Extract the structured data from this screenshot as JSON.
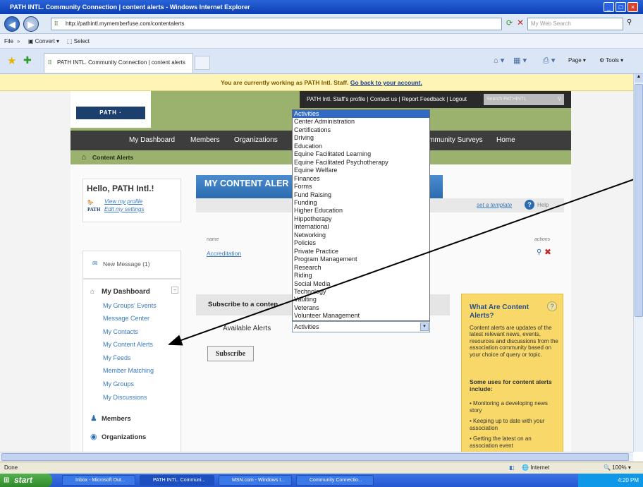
{
  "window": {
    "title": "PATH INTL. Community Connection | content alerts - Windows Internet Explorer"
  },
  "browser": {
    "url": "http://pathintl.mymemberfuse.com/contentalerts",
    "search_placeholder": "My Web Search",
    "menu": {
      "file": "File",
      "convert": "Convert",
      "select": "Select"
    },
    "tab_title": "PATH INTL. Community Connection | content alerts",
    "tools": {
      "page": "Page",
      "tools": "Tools"
    }
  },
  "infobar": {
    "text": "You are currently working as PATH Intl. Staff.",
    "link": "Go back to your account."
  },
  "site": {
    "top_links": "PATH Intl. Staff's profile | Contact us | Report Feedback | Logout",
    "search_placeholder": "Search PATHINTL",
    "nav": [
      "My Dashboard",
      "Members",
      "Organizations",
      "mmunity Surveys",
      "Home"
    ],
    "breadcrumb": "Content Alerts"
  },
  "sidebar": {
    "greeting": "Hello, PATH Intl.!",
    "view_profile": "View my profile",
    "edit_settings": "Edit my settings",
    "new_message": "New Message (1)",
    "dashboard_title": "My Dashboard",
    "items": [
      "My Groups' Events",
      "Message Center",
      "My Contacts",
      "My Content Alerts",
      "My Feeds",
      "Member Matching",
      "My Groups",
      "My Discussions"
    ],
    "members": "Members",
    "organizations": "Organizations"
  },
  "content": {
    "title": "MY CONTENT ALER",
    "set_template": "set a template",
    "help": "Help",
    "col_name": "name",
    "col_actions": "actions",
    "row": "Accreditation",
    "subscribe_title": "Subscribe to a conten",
    "available_alerts": "Available Alerts",
    "subscribe_button": "Subscribe"
  },
  "dropdown": {
    "selected": "Activities",
    "options": [
      "Activities",
      "Center Administration",
      "Certifications",
      "Driving",
      "Education",
      "Equine Facilitated Learning",
      "Equine Facilitated Psychotherapy",
      "Equine Welfare",
      "Finances",
      "Forms",
      "Fund Raising",
      "Funding",
      "Higher Education",
      "Hippotherapy",
      "International",
      "Networking",
      "Policies",
      "Private Practice",
      "Program Management",
      "Research",
      "Riding",
      "Social Media",
      "Technology",
      "Vaulting",
      "Veterans",
      "Volunteer Management"
    ]
  },
  "whatbox": {
    "title": "What Are Content Alerts?",
    "body": "Content alerts are updates of the latest relevant news, events, resources and discussions from the association community based on your choice of query or topic.",
    "uses_title": "Some uses for content alerts include:",
    "uses": [
      "Monitoring a developing news story",
      "Keeping up to date with your association",
      "Getting the latest on an association event"
    ]
  },
  "statusbar": {
    "left": "Done",
    "zone": "Internet",
    "zoom": "100%"
  },
  "taskbar": {
    "start": "start",
    "tasks": [
      "Inbox - Microsoft Out...",
      "PATH INTL. Communi...",
      "MSN.com - Windows I...",
      "Community Connectio..."
    ],
    "clock": "4:20 PM"
  },
  "colors": {
    "accent_green": "#9bb16e",
    "header_blue": "#2b6cb0",
    "arrow": "#000000"
  }
}
